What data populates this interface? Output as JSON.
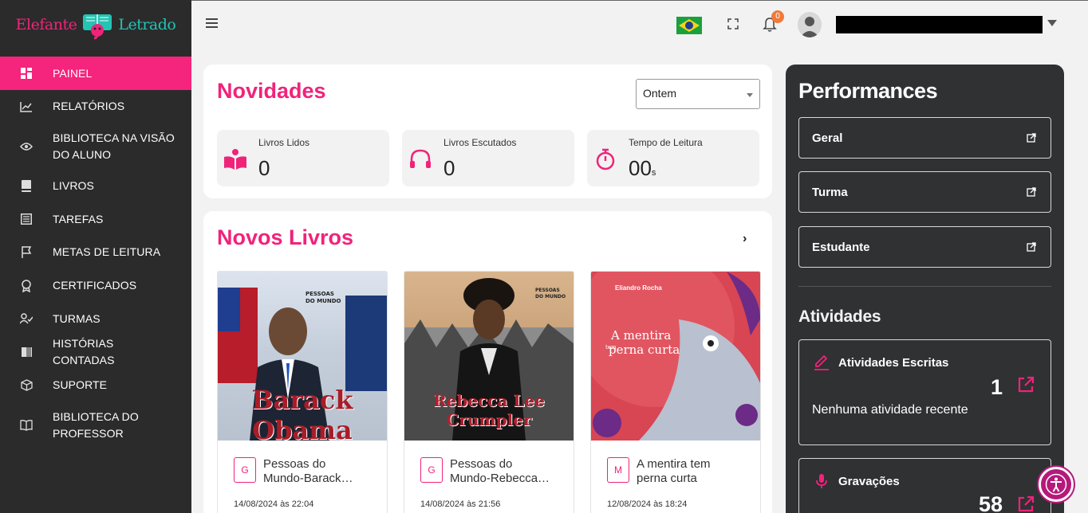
{
  "brand": {
    "part1": "Elefante",
    "part2": "Letrado"
  },
  "sidebar": {
    "items": [
      {
        "label": "PAINEL",
        "icon": "dashboard-icon"
      },
      {
        "label": "RELATÓRIOS",
        "icon": "chart-icon"
      },
      {
        "label": "BIBLIOTECA NA VISÃO DO ALUNO",
        "icon": "eye-icon"
      },
      {
        "label": "LIVROS",
        "icon": "book-icon"
      },
      {
        "label": "TAREFAS",
        "icon": "list-icon"
      },
      {
        "label": "METAS DE LEITURA",
        "icon": "flag-icon"
      },
      {
        "label": "CERTIFICADOS",
        "icon": "award-icon"
      },
      {
        "label": "TURMAS",
        "icon": "users-icon"
      },
      {
        "label": "HISTÓRIAS CONTADAS",
        "icon": "book-open-icon"
      },
      {
        "label": "SUPORTE",
        "icon": "box-icon"
      },
      {
        "label": "BIBLIOTECA DO PROFESSOR",
        "icon": "library-icon"
      }
    ]
  },
  "topbar": {
    "notifications_count": "0"
  },
  "novidades": {
    "title": "Novidades",
    "period": "Ontem",
    "stats": [
      {
        "label": "Livros Lidos",
        "value": "0",
        "unit": ""
      },
      {
        "label": "Livros Escutados",
        "value": "0",
        "unit": ""
      },
      {
        "label": "Tempo de Leitura",
        "value": "00",
        "unit": "s"
      }
    ]
  },
  "novos_livros": {
    "title": "Novos Livros",
    "books": [
      {
        "letter": "G",
        "name_line1": "Pessoas do",
        "name_line2": "Mundo-Barack…",
        "date": "14/08/2024 às 22:04",
        "cover_title": "Barack Obama"
      },
      {
        "letter": "G",
        "name_line1": "Pessoas do",
        "name_line2": "Mundo-Rebecca…",
        "date": "14/08/2024 às 21:56",
        "cover_title": "Rebecca Lee Crumpler"
      },
      {
        "letter": "M",
        "name_line1": "A mentira tem",
        "name_line2": "perna curta",
        "date": "12/08/2024 às 18:24",
        "cover_title": "A mentira tem perna curta",
        "cover_author": "Eliandro Rocha"
      }
    ]
  },
  "performances": {
    "title": "Performances",
    "buttons": [
      "Geral",
      "Turma",
      "Estudante"
    ],
    "activities_title": "Atividades",
    "written": {
      "label": "Atividades Escritas",
      "count": "1",
      "empty_text": "Nenhuma atividade recente"
    },
    "recordings": {
      "label": "Gravações",
      "count": "58"
    }
  },
  "colors": {
    "accent": "#f0237a",
    "sidebar_bg": "#2b2b2b",
    "panel_bg": "#303133",
    "teal": "#22c4b4"
  }
}
